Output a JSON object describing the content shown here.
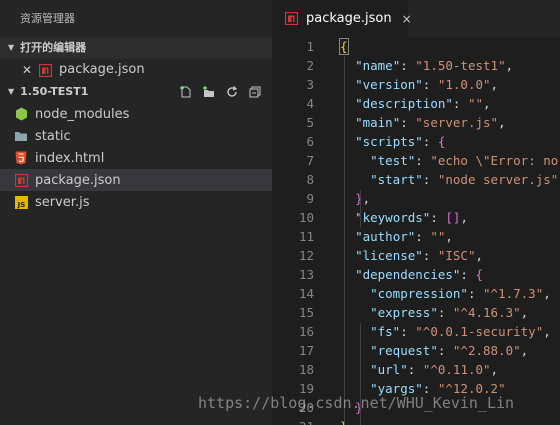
{
  "sidebar": {
    "title": "资源管理器",
    "open_editors": {
      "header": "打开的编辑器",
      "items": [
        {
          "label": "package.json",
          "icon": "npm-icon"
        }
      ]
    },
    "project": {
      "header": "1.50-TEST1",
      "files": [
        {
          "label": "node_modules",
          "icon": "node-folder-icon"
        },
        {
          "label": "static",
          "icon": "folder-icon"
        },
        {
          "label": "index.html",
          "icon": "html5-icon"
        },
        {
          "label": "package.json",
          "icon": "npm-icon",
          "selected": true
        },
        {
          "label": "server.js",
          "icon": "js-icon"
        }
      ]
    }
  },
  "editor": {
    "tab": {
      "label": "package.json",
      "close": "×"
    },
    "line_numbers": [
      "1",
      "2",
      "3",
      "4",
      "5",
      "6",
      "7",
      "8",
      "9",
      "10",
      "11",
      "12",
      "13",
      "14",
      "15",
      "16",
      "17",
      "18",
      "19",
      "20",
      "21"
    ]
  },
  "watermark": "https://blog.csdn.net/WHU_Kevin_Lin",
  "colors": {
    "sidebar_bg": "#252526",
    "editor_bg": "#1e1e1e",
    "key": "#9cdcfe",
    "string": "#ce9178",
    "bracket": "#ffd700",
    "bracket2": "#da70d6"
  }
}
